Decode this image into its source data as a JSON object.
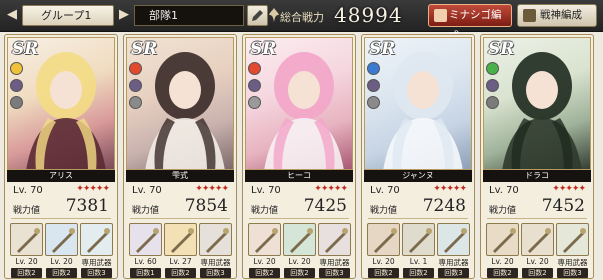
{
  "header": {
    "group_label": "グループ1",
    "team_label": "部隊1",
    "total_power_label": "総合戦力",
    "total_power_value": "48994",
    "mina_button": "ミナシゴ編成",
    "senjin_button": "戦神編成"
  },
  "colors": {
    "accent_red": "#c02a1e",
    "card_bg": "#f4eedf",
    "border_gold": "#a58d5c"
  },
  "labels": {
    "lv_prefix": "Lv. 70",
    "cp_label": "戦力値",
    "stars": "✦✦✦✦✦"
  },
  "cards": [
    {
      "rarity": "SR",
      "name": "アリス",
      "level": "Lv. 70",
      "power": "7381",
      "elements": [
        "light",
        "dark",
        "gun"
      ],
      "slots": [
        {
          "lv": "Lv. 20",
          "tag": "回数2"
        },
        {
          "lv": "Lv. 20",
          "tag": "回数2"
        },
        {
          "lv": "専用武器",
          "tag": "回数3"
        }
      ]
    },
    {
      "rarity": "SR",
      "name": "雫式",
      "level": "Lv. 70",
      "power": "7854",
      "elements": [
        "fire",
        "dark",
        "sword"
      ],
      "slots": [
        {
          "lv": "Lv. 60",
          "tag": "回数1"
        },
        {
          "lv": "Lv. 27",
          "tag": "回数2"
        },
        {
          "lv": "専用武器",
          "tag": "回数3"
        }
      ]
    },
    {
      "rarity": "SR",
      "name": "ヒーコ",
      "level": "Lv. 70",
      "power": "7425",
      "elements": [
        "fire",
        "dark",
        "spear"
      ],
      "slots": [
        {
          "lv": "Lv. 20",
          "tag": "回数2"
        },
        {
          "lv": "Lv. 20",
          "tag": "回数2"
        },
        {
          "lv": "専用武器",
          "tag": "回数3"
        }
      ]
    },
    {
      "rarity": "SR",
      "name": "ジャンヌ",
      "level": "Lv. 70",
      "power": "7248",
      "elements": [
        "water",
        "dark",
        "sword"
      ],
      "slots": [
        {
          "lv": "Lv. 20",
          "tag": "回数2"
        },
        {
          "lv": "Lv. 1",
          "tag": "回数2"
        },
        {
          "lv": "専用武器",
          "tag": "回数3"
        }
      ]
    },
    {
      "rarity": "SR",
      "name": "ドラコ",
      "level": "Lv. 70",
      "power": "7452",
      "elements": [
        "wind",
        "dark",
        "gun"
      ],
      "slots": [
        {
          "lv": "Lv. 20",
          "tag": "回数2"
        },
        {
          "lv": "Lv. 20",
          "tag": "回数2"
        },
        {
          "lv": "専用武器",
          "tag": "回数3"
        }
      ]
    }
  ]
}
